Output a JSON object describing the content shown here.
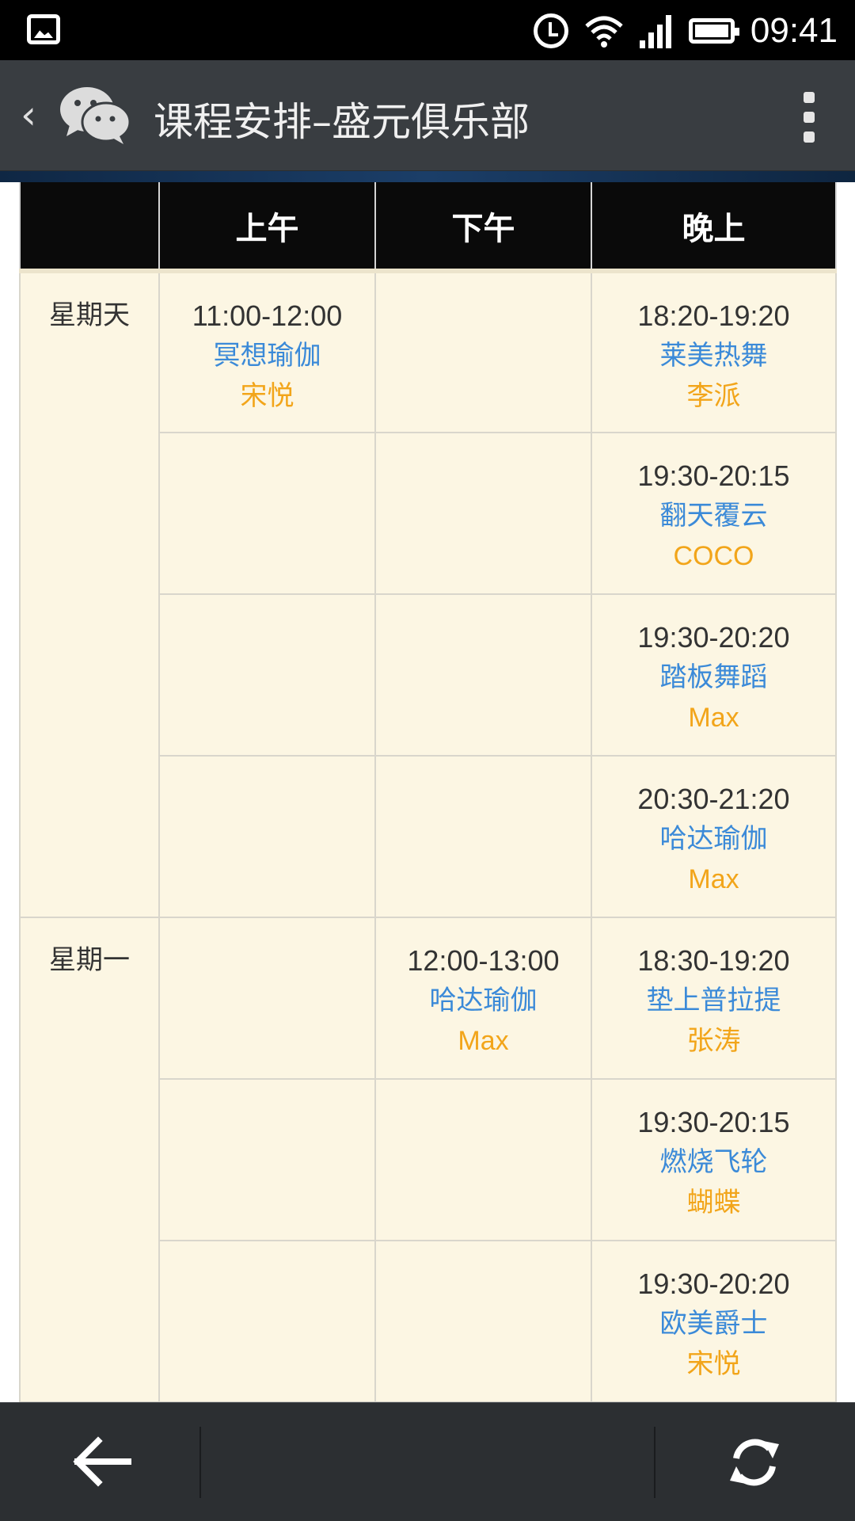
{
  "status_bar": {
    "time": "09:41"
  },
  "app_bar": {
    "back_glyph": "‹",
    "title": "课程安排–盛元俱乐部"
  },
  "schedule": {
    "headers": [
      "",
      "上午",
      "下午",
      "晚上"
    ],
    "days": [
      {
        "day": "星期天",
        "rows": [
          {
            "morning": {
              "time": "11:00-12:00",
              "name": "冥想瑜伽",
              "teacher": "宋悦"
            },
            "afternoon": null,
            "evening": {
              "time": "18:20-19:20",
              "name": "莱美热舞",
              "teacher": "李派"
            }
          },
          {
            "morning": null,
            "afternoon": null,
            "evening": {
              "time": "19:30-20:15",
              "name": "翻天覆云",
              "teacher": "COCO"
            }
          },
          {
            "morning": null,
            "afternoon": null,
            "evening": {
              "time": "19:30-20:20",
              "name": "踏板舞蹈",
              "teacher": "Max"
            }
          },
          {
            "morning": null,
            "afternoon": null,
            "evening": {
              "time": "20:30-21:20",
              "name": "哈达瑜伽",
              "teacher": "Max"
            }
          }
        ]
      },
      {
        "day": "星期一",
        "rows": [
          {
            "morning": null,
            "afternoon": {
              "time": "12:00-13:00",
              "name": "哈达瑜伽",
              "teacher": "Max"
            },
            "evening": {
              "time": "18:30-19:20",
              "name": "垫上普拉提",
              "teacher": "张涛"
            }
          },
          {
            "morning": null,
            "afternoon": null,
            "evening": {
              "time": "19:30-20:15",
              "name": "燃烧飞轮",
              "teacher": "蝴蝶"
            }
          },
          {
            "morning": null,
            "afternoon": null,
            "evening": {
              "time": "19:30-20:20",
              "name": "欧美爵士",
              "teacher": "宋悦"
            }
          }
        ]
      }
    ]
  },
  "colors": {
    "course_name": "#3b8ad8",
    "teacher": "#f2a51a",
    "cell_bg": "#fcf6e3",
    "header_bg": "#0a0a0a"
  },
  "icons": [
    "image-icon",
    "alarm-icon",
    "wifi-icon",
    "signal-icon",
    "battery-icon",
    "wechat-logo-icon",
    "more-icon",
    "back-arrow-icon",
    "refresh-icon"
  ]
}
